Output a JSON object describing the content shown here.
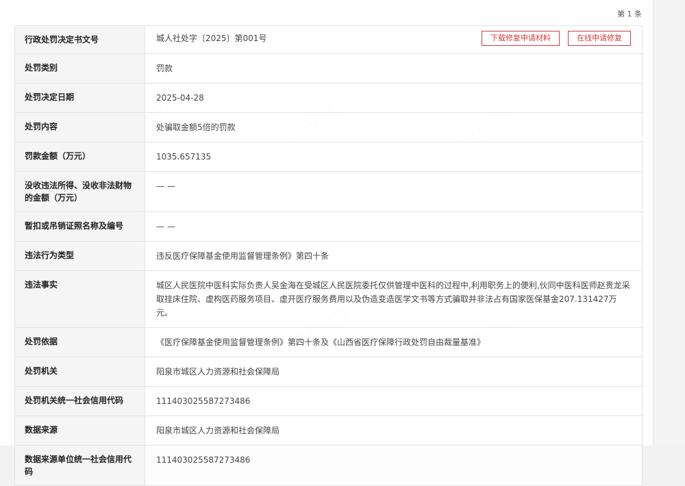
{
  "pagination": {
    "count_label": "第 1 条"
  },
  "watermark": {
    "text": "信用中国"
  },
  "actions": {
    "download_label": "下载修复申请材料",
    "online_label": "在线申请修复"
  },
  "record": {
    "rows": [
      {
        "key": "行政处罚决定书文号",
        "value": "城人社处字〔2025〕第001号"
      },
      {
        "key": "处罚类别",
        "value": "罚款"
      },
      {
        "key": "处罚决定日期",
        "value": "2025-04-28"
      },
      {
        "key": "处罚内容",
        "value": "处骗取金额5倍的罚款"
      },
      {
        "key": "罚款金额（万元）",
        "value": "1035.657135"
      },
      {
        "key": "没收违法所得、没收非法财物的金额（万元）",
        "value": "— —"
      },
      {
        "key": "暂扣或吊销证照名称及编号",
        "value": "— —"
      },
      {
        "key": "违法行为类型",
        "value": "违反医疗保障基金使用监督管理条例》第四十条"
      },
      {
        "key": "违法事实",
        "value": "城区人民医院中医科实际负责人吴金海在受城区人民医院委托仅供管理中医科的过程中,利用职务上的便利,伙同中医科医师赵贵龙采取挂床住院、虚构医药服务项目、虚开医疗服务费用以及伪造变造医学文书等方式骗取并非法占有国家医保基金207.131427万元。"
      },
      {
        "key": "处罚依据",
        "value": "《医疗保障基金使用监督管理条例》第四十条及《山西省医疗保障行政处罚自由裁量基准》"
      },
      {
        "key": "处罚机关",
        "value": "阳泉市城区人力资源和社会保障局"
      },
      {
        "key": "处罚机关统一社会信用代码",
        "value": "11140302558727348​6"
      },
      {
        "key": "数据来源",
        "value": "阳泉市城区人力资源和社会保障局"
      },
      {
        "key": "数据来源单位统一社会信用代码",
        "value": "111403025587273486"
      }
    ]
  }
}
